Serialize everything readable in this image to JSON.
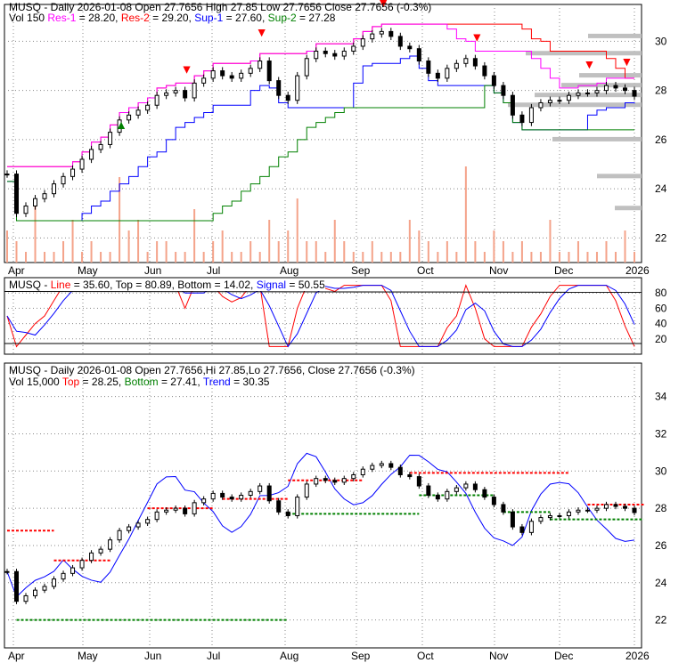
{
  "chart_data": [
    {
      "type": "candlestick",
      "symbol": "MUSQ",
      "title": "MUSQ - Daily 2026-01-08 Open 27.7656  High 27.85  Low 27.7656  Close 27.7656 (-0.3%)",
      "legend": {
        "vol": "Vol 150",
        "res1": "Res-1",
        "res1_val": "= 28.20,",
        "res2": "Res-2",
        "res2_val": "= 29.20,",
        "sup1": "Sup-1",
        "sup1_val": "= 27.60,",
        "sup2": "Sup-2",
        "sup2_val": "= 27.28"
      },
      "y_ticks": [
        "30",
        "28",
        "26",
        "24",
        "22"
      ],
      "ylim": [
        21,
        31.5
      ],
      "x_ticks": [
        "Apr",
        "May",
        "Jun",
        "Jul",
        "Aug",
        "Sep",
        "Oct",
        "Nov",
        "Dec",
        "2026"
      ],
      "closes": [
        24.6,
        23.0,
        23.3,
        23.6,
        23.8,
        24.2,
        24.5,
        24.8,
        25.2,
        25.6,
        25.8,
        26.3,
        26.8,
        27.0,
        27.2,
        27.4,
        27.8,
        27.9,
        28.0,
        27.7,
        28.3,
        28.5,
        28.8,
        28.6,
        28.5,
        28.7,
        28.9,
        29.2,
        28.4,
        27.8,
        27.6,
        28.6,
        29.3,
        29.6,
        29.5,
        29.4,
        29.6,
        29.8,
        30.1,
        30.3,
        30.4,
        30.2,
        29.8,
        29.7,
        29.2,
        28.7,
        28.5,
        28.9,
        29.1,
        29.3,
        29.0,
        28.6,
        28.2,
        27.8,
        27.0,
        26.7,
        27.3,
        27.5,
        27.6,
        27.6,
        27.8,
        27.9,
        27.9,
        28.0,
        28.2,
        28.1,
        28.0,
        27.77
      ],
      "volumes": [
        3,
        2,
        1,
        6,
        1,
        1,
        2,
        4,
        1,
        2,
        1,
        1,
        8,
        3,
        4,
        1,
        2,
        2,
        1,
        1,
        5,
        1,
        2,
        3,
        1,
        1,
        2,
        1,
        4,
        2,
        3,
        6,
        2,
        2,
        1,
        4,
        2,
        1,
        1,
        2,
        1,
        1,
        1,
        4,
        3,
        2,
        1,
        2,
        1,
        9,
        2,
        1,
        3,
        2,
        1,
        2,
        1,
        1,
        4,
        1,
        1,
        2,
        1,
        1,
        2,
        1,
        3,
        1
      ],
      "colors": {
        "res1": "#ff00ff",
        "res2": "#ff0000",
        "sup1": "#0000ff",
        "sup2": "#008000",
        "volume": "#f4a38a"
      }
    },
    {
      "type": "line",
      "legend": {
        "prefix": "MUSQ -",
        "line": "Line",
        "line_val": "= 35.60,",
        "top": "Top = 80.89, Bottom = 14.02,",
        "signal": "Signal",
        "signal_val": "= 50.55"
      },
      "y_ticks": [
        "80",
        "60",
        "40",
        "20"
      ],
      "ylim": [
        0,
        100
      ]
    },
    {
      "type": "candlestick",
      "title": "MUSQ - Daily 2026-01-08 Open 27.7656,Hi 27.85,Lo 27.7656, Close 27.7656 (-0.3%)",
      "legend": {
        "vol": "Vol 15,000",
        "top": "Top",
        "top_val": "= 28.25,",
        "bottom": "Bottom",
        "bottom_val": "= 27.41,",
        "trend": "Trend",
        "trend_val": "= 30.35"
      },
      "y_ticks": [
        "34",
        "32",
        "30",
        "28",
        "26",
        "24",
        "22"
      ],
      "ylim": [
        20.5,
        35.8
      ],
      "x_ticks": [
        "Apr",
        "May",
        "Jun",
        "Jul",
        "Aug",
        "Sep",
        "Oct",
        "Nov",
        "Dec",
        "2026"
      ]
    }
  ]
}
